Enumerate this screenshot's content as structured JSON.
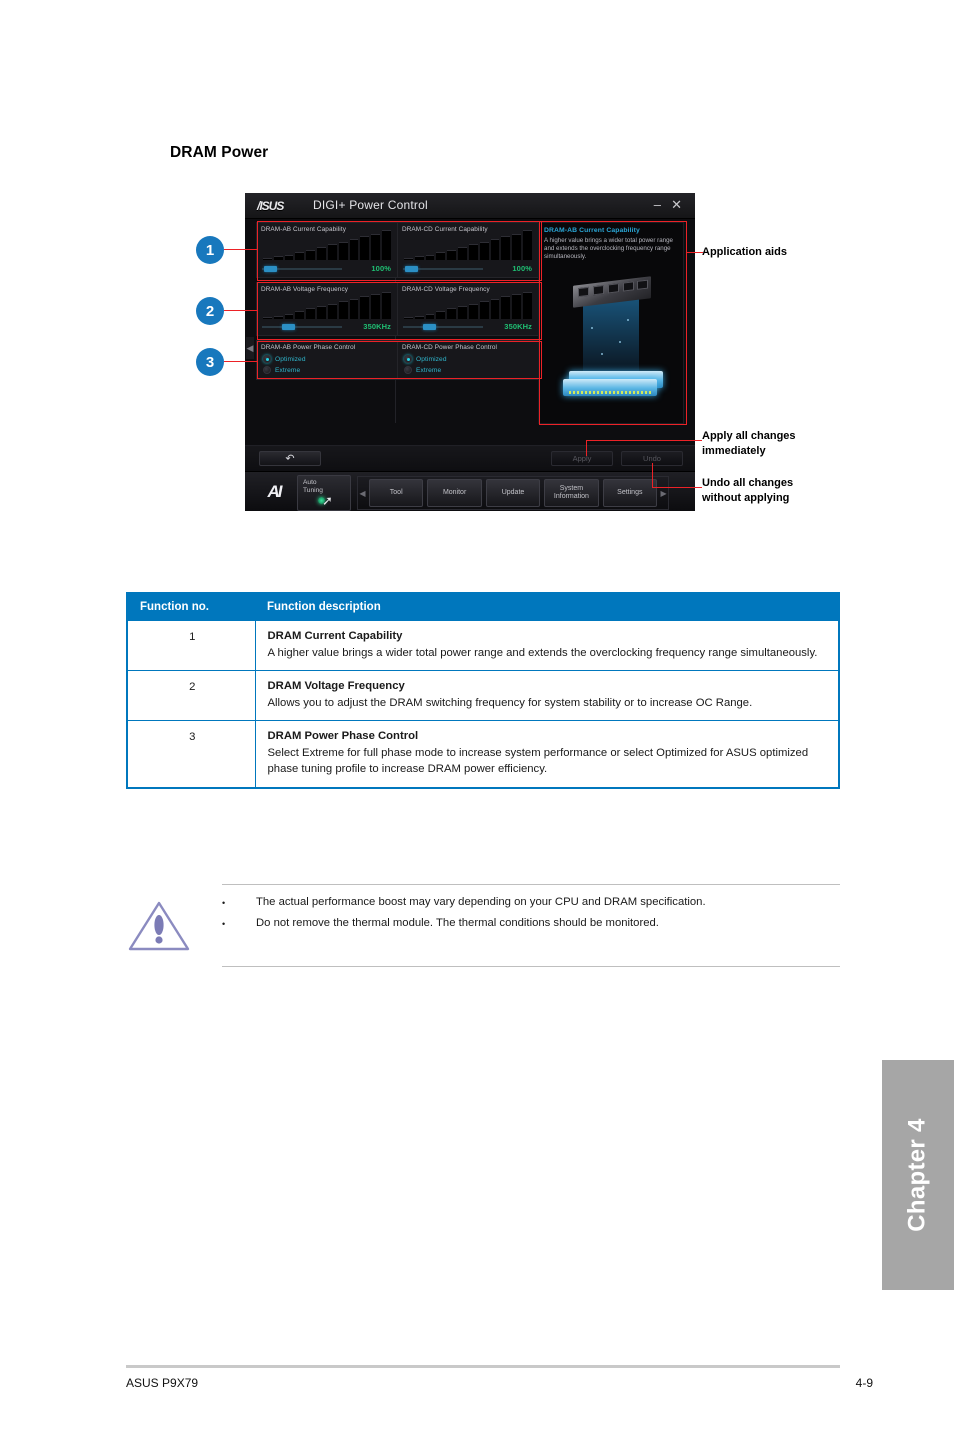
{
  "page": {
    "title": "DRAM Power",
    "footer_left": "ASUS P9X79",
    "footer_right": "4-9",
    "chapter_tab": "Chapter 4"
  },
  "app": {
    "brand": "/ISUS",
    "window_title": "DIGI+ Power Control",
    "minimize_label": "–",
    "close_label": "✕",
    "side_arrow": "◀",
    "cards": {
      "current_capability": [
        {
          "label": "DRAM-AB Current Capability",
          "value": "100%",
          "slider_pct": 4
        },
        {
          "label": "DRAM-CD Current Capability",
          "value": "100%",
          "slider_pct": 4
        }
      ],
      "voltage_frequency": [
        {
          "label": "DRAM-AB Voltage Frequency",
          "value": "350KHz",
          "slider_pct": 26
        },
        {
          "label": "DRAM-CD Voltage Frequency",
          "value": "350KHz",
          "slider_pct": 26
        }
      ],
      "power_phase_control": [
        {
          "label": "DRAM-AB Power Phase Control",
          "options": [
            {
              "label": "Optimized",
              "selected": true
            },
            {
              "label": "Extreme",
              "selected": false
            }
          ]
        },
        {
          "label": "DRAM-CD Power Phase Control",
          "options": [
            {
              "label": "Optimized",
              "selected": true
            },
            {
              "label": "Extreme",
              "selected": false
            }
          ]
        }
      ]
    },
    "aid_panel": {
      "title": "DRAM-AB Current Capability",
      "text": "A higher value brings a wider total power range and extends the overclocking frequency range simultaneously."
    },
    "action_bar": {
      "reset_label": "↶",
      "apply_label": "Apply",
      "undo_label": "Undo"
    },
    "nav": {
      "ai_logo": "AI",
      "auto_tuning_line1": "Auto",
      "auto_tuning_line2": "Tuning",
      "prev_arrow": "◀",
      "next_arrow": "▶",
      "items": [
        {
          "label": "Tool"
        },
        {
          "label": "Monitor"
        },
        {
          "label": "Update"
        },
        {
          "label": "System Information"
        },
        {
          "label": "Settings"
        }
      ]
    }
  },
  "callouts": {
    "numbers": [
      "1",
      "2",
      "3"
    ],
    "labels": {
      "application_aids": "Application aids",
      "apply_line1": "Apply all changes",
      "apply_line2": "immediately",
      "undo_line1": "Undo all changes",
      "undo_line2": "without applying"
    }
  },
  "table": {
    "headers": [
      "Function no.",
      "Function description"
    ],
    "rows": [
      {
        "no": "1",
        "title": "DRAM Current Capability",
        "body": "A higher value brings a wider total power range and extends the overclocking frequency range simultaneously."
      },
      {
        "no": "2",
        "title": "DRAM Voltage Frequency",
        "body": "Allows you to adjust the DRAM switching frequency for system stability or to increase OC Range."
      },
      {
        "no": "3",
        "title": "DRAM Power Phase Control",
        "body": "Select Extreme for full phase mode to increase system performance or select Optimized for ASUS optimized phase tuning profile to increase DRAM power efficiency."
      }
    ]
  },
  "note": {
    "bullet": "•",
    "items": [
      "The actual performance boost may vary depending on your CPU and DRAM specification.",
      "Do not remove the thermal module. The thermal conditions should be monitored."
    ]
  },
  "colors": {
    "accent_blue": "#0077bd",
    "callout_blue": "#1878bd",
    "highlight_red": "#ec2227",
    "value_green": "#1fbf73",
    "radio_cyan": "#26d7e8",
    "chapter_gray": "#a6a6a6"
  }
}
